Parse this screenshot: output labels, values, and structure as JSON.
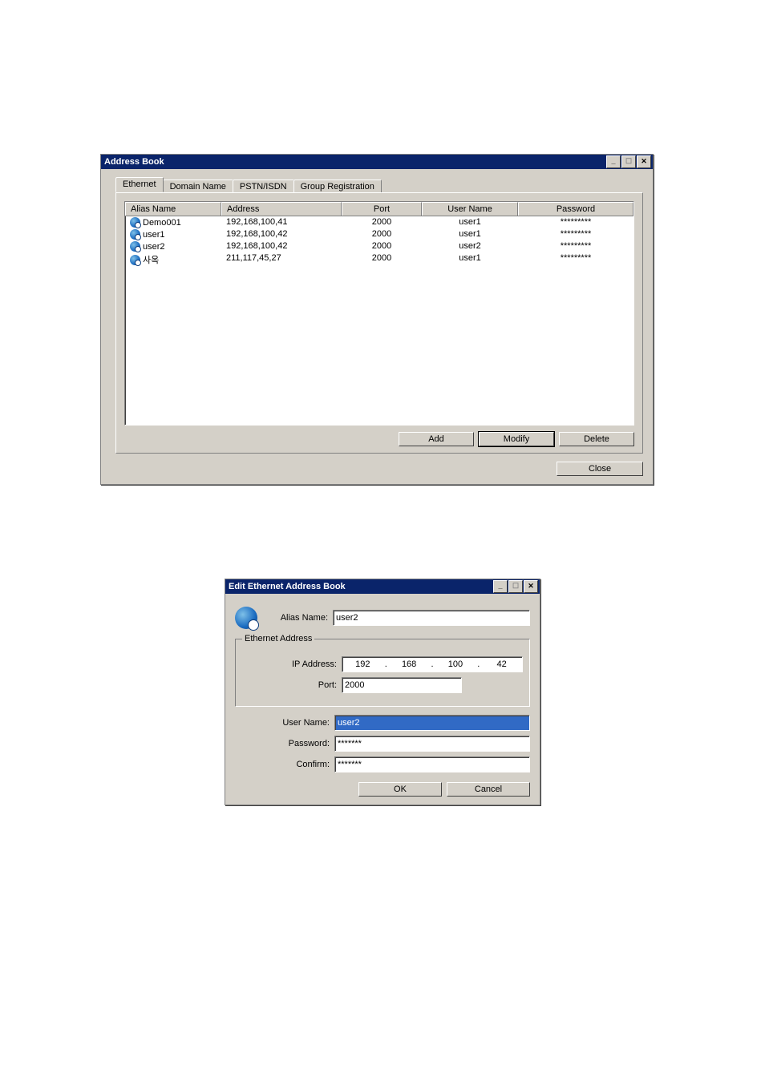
{
  "win1": {
    "title": "Address Book",
    "tabs": [
      "Ethernet",
      "Domain Name",
      "PSTN/ISDN",
      "Group Registration"
    ],
    "columns": [
      "Alias Name",
      "Address",
      "Port",
      "User Name",
      "Password"
    ],
    "rows": [
      {
        "alias": "Demo001",
        "address": "192,168,100,41",
        "port": "2000",
        "user": "user1",
        "pass": "*********"
      },
      {
        "alias": "user1",
        "address": "192,168,100,42",
        "port": "2000",
        "user": "user1",
        "pass": "*********"
      },
      {
        "alias": "user2",
        "address": "192,168,100,42",
        "port": "2000",
        "user": "user2",
        "pass": "*********"
      },
      {
        "alias": "사옥",
        "address": "211,117,45,27",
        "port": "2000",
        "user": "user1",
        "pass": "*********"
      }
    ],
    "buttons": {
      "add": "Add",
      "modify": "Modify",
      "delete": "Delete",
      "close": "Close"
    }
  },
  "win2": {
    "title": "Edit Ethernet Address Book",
    "labels": {
      "alias": "Alias Name:",
      "group": "Ethernet Address",
      "ip": "IP Address:",
      "port": "Port:",
      "user": "User Name:",
      "pass": "Password:",
      "confirm": "Confirm:"
    },
    "values": {
      "alias": "user2",
      "ip": [
        "192",
        "168",
        "100",
        "42"
      ],
      "port": "2000",
      "user": "user2",
      "pass": "*******",
      "confirm": "*******"
    },
    "buttons": {
      "ok": "OK",
      "cancel": "Cancel"
    }
  }
}
